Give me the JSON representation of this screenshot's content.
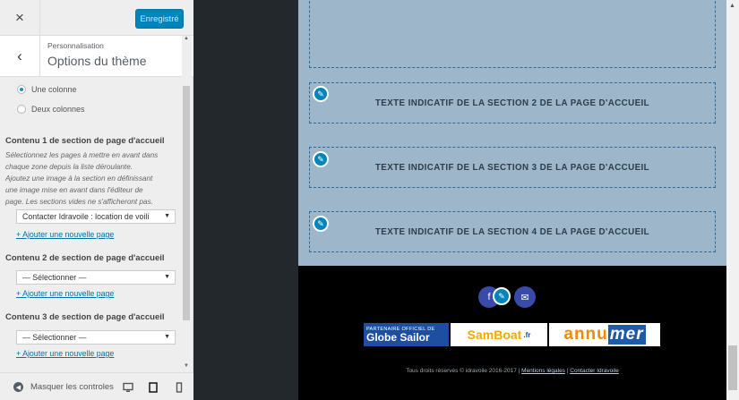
{
  "header": {
    "close_icon": "×",
    "publish_label": "Enregistré"
  },
  "panel": {
    "back_icon": "‹",
    "breadcrumb": "Personnalisation",
    "title": "Options du thème"
  },
  "layout_choice": {
    "option1": "Une colonne",
    "option2": "Deux colonnes",
    "selected": "Une colonne"
  },
  "content1": {
    "title": "Contenu 1 de section de page d'accueil",
    "desc_lines": [
      "Sélectionnez les pages à mettre en avant dans",
      "chaque zone depuis la liste déroulante.",
      "Ajoutez une image à la section en définissant",
      "une image mise en avant dans l'éditeur de",
      "page. Les sections vides ne s'afficheront pas."
    ],
    "select_value": "Contacter Idravoile : location de voili",
    "add_link": "+ Ajouter une nouvelle page"
  },
  "content2": {
    "title": "Contenu 2 de section de page d'accueil",
    "select_value": "— Sélectionner —",
    "add_link": "+ Ajouter une nouvelle page"
  },
  "content3": {
    "title": "Contenu 3 de section de page d'accueil",
    "select_value": "— Sélectionner —",
    "add_link": "+ Ajouter une nouvelle page"
  },
  "footer_controls": {
    "hide_label": "Masquer les controles",
    "devices": [
      "desktop-icon",
      "tablet-icon",
      "mobile-icon"
    ]
  },
  "preview": {
    "sections": [
      "TEXTE INDICATIF DE LA SECTION 2 DE LA PAGE D'ACCUEIL",
      "TEXTE INDICATIF DE LA SECTION 3 DE LA PAGE D'ACCUEIL",
      "TEXTE INDICATIF DE LA SECTION 4 DE LA PAGE D'ACCUEIL"
    ],
    "partners": {
      "globe_small": "PARTENAIRE OFFICIEL DE",
      "globe_big": "Globe Sailor",
      "samboat": "SamBoat",
      "samboat_tld": ".fr",
      "annu": "annu",
      "mer": "mer"
    },
    "copyright": "Tous droits réservés © idravoile 2016-2017 |",
    "legal_link": "Mentions légales",
    "contact_link": "Contacter Idravoile"
  },
  "colors": {
    "accent": "#0085ba",
    "site_bg": "#9db6c9",
    "footer_bg": "#000000"
  }
}
